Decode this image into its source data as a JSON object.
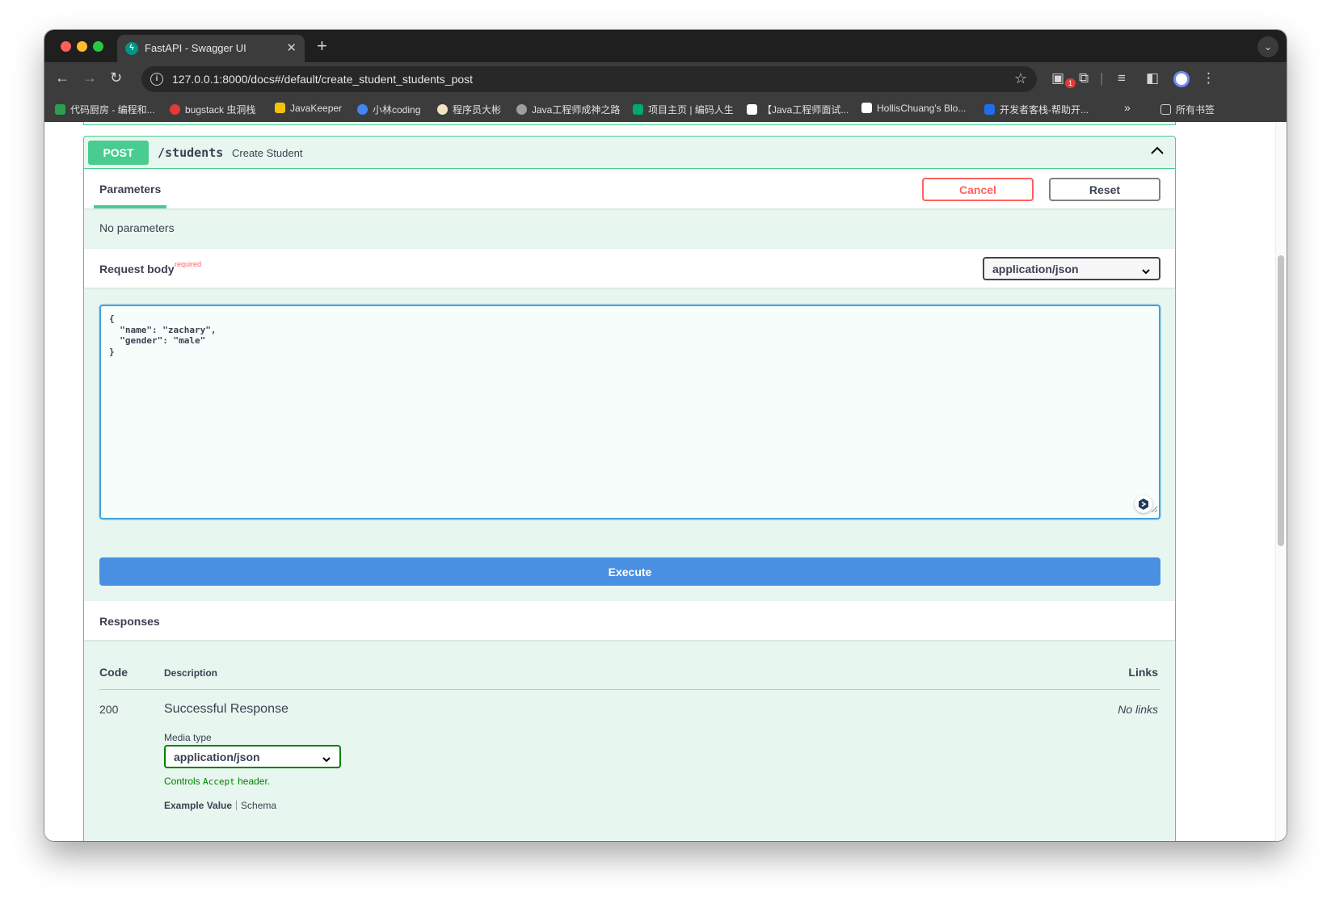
{
  "browser": {
    "tab_title": "FastAPI - Swagger UI",
    "tab_favicon": "fastapi-icon",
    "url": "127.0.0.1:8000/docs#/default/create_student_students_post",
    "extension_badge": "1",
    "bookmarks": [
      {
        "label": "代码厨房 - 编程和...",
        "color": "#2e9e4f"
      },
      {
        "label": "bugstack 虫洞栈",
        "color": "#e53935"
      },
      {
        "label": "JavaKeeper",
        "color": "#f4c20d"
      },
      {
        "label": "小林coding",
        "color": "#4285f4"
      },
      {
        "label": "程序员大彬",
        "color": "#f1e3c4"
      },
      {
        "label": "Java工程师成神之路",
        "color": "#9e9e9e"
      },
      {
        "label": "项目主页 | 编码人生",
        "color": "#00a86b"
      },
      {
        "label": "【Java工程师面试...",
        "color": "#ffffff"
      },
      {
        "label": "HollisChuang's Blo...",
        "color": "#ffffff"
      },
      {
        "label": "开发者客栈-帮助开...",
        "color": "#1e6ee8"
      }
    ],
    "bookmarks_overflow": "»",
    "all_bookmarks": "所有书签"
  },
  "operation": {
    "method": "POST",
    "path": "/students",
    "summary": "Create Student",
    "tab_parameters": "Parameters",
    "cancel_label": "Cancel",
    "reset_label": "Reset",
    "no_parameters": "No parameters",
    "request_body_label": "Request body",
    "required_label": "required",
    "content_type": "application/json",
    "body_text": "{\n  \"name\": \"zachary\",\n  \"gender\": \"male\"\n}",
    "execute_label": "Execute"
  },
  "responses": {
    "title": "Responses",
    "col_code": "Code",
    "col_description": "Description",
    "col_links": "Links",
    "rows": [
      {
        "code": "200",
        "description": "Successful Response",
        "links": "No links",
        "media_type_label": "Media type",
        "media_type": "application/json",
        "controls_note_prefix": "Controls ",
        "controls_note_code": "Accept",
        "controls_note_suffix": " header.",
        "example_tab": "Example Value",
        "schema_tab": "Schema"
      }
    ]
  },
  "colors": {
    "post_green": "#49cc90",
    "execute_blue": "#4990e2",
    "cancel_red": "#ff6060"
  }
}
